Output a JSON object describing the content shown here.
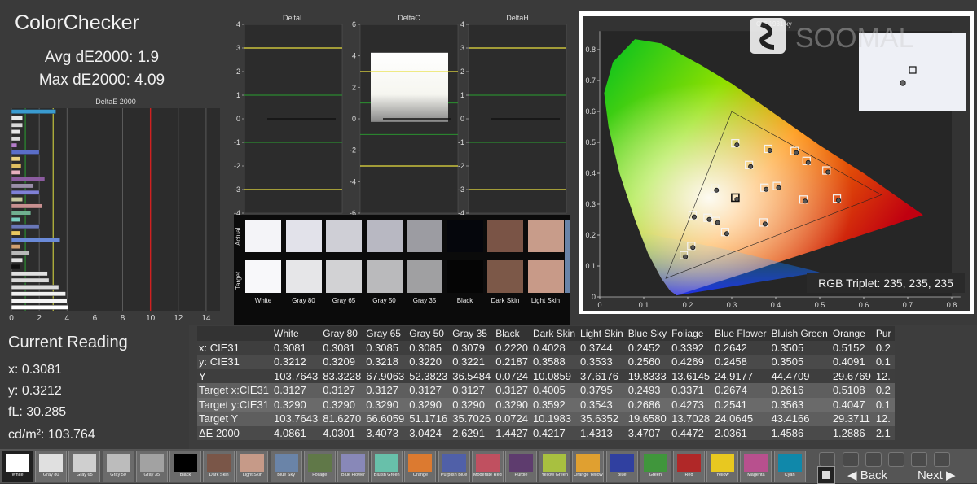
{
  "header": {
    "title": "ColorChecker",
    "avg": "Avg dE2000: 1.9",
    "max": "Max dE2000: 4.09"
  },
  "deltae_chart": {
    "title": "DeltaE 2000",
    "ticks": [
      "0",
      "2",
      "4",
      "6",
      "8",
      "10",
      "12",
      "14"
    ],
    "xlim": [
      0,
      15
    ],
    "bars": [
      {
        "value": 3.2,
        "color": "#3a9bd0"
      },
      {
        "value": 0.8,
        "color": "#e8e8e8"
      },
      {
        "value": 0.8,
        "color": "#d8d8d8"
      },
      {
        "value": 0.6,
        "color": "#e8e8e8"
      },
      {
        "value": 0.6,
        "color": "#dcdcdc"
      },
      {
        "value": 0.4,
        "color": "#b37cc8"
      },
      {
        "value": 2.0,
        "color": "#5a6ec8"
      },
      {
        "value": 0.6,
        "color": "#e8d080"
      },
      {
        "value": 0.7,
        "color": "#e0c060"
      },
      {
        "value": 0.6,
        "color": "#e8b0c0"
      },
      {
        "value": 2.4,
        "color": "#8c5ca0"
      },
      {
        "value": 1.6,
        "color": "#9a8ea8"
      },
      {
        "value": 2.0,
        "color": "#7f80d6"
      },
      {
        "value": 0.8,
        "color": "#c8c8a0"
      },
      {
        "value": 2.2,
        "color": "#c89090"
      },
      {
        "value": 1.4,
        "color": "#70b090"
      },
      {
        "value": 0.6,
        "color": "#7ad0c0"
      },
      {
        "value": 2.0,
        "color": "#6a78b8"
      },
      {
        "value": 0.6,
        "color": "#e8c860"
      },
      {
        "value": 3.5,
        "color": "#6a8ad8"
      },
      {
        "value": 0.6,
        "color": "#d0a070"
      },
      {
        "value": 1.3,
        "color": "#b8b8b8"
      },
      {
        "value": 0.8,
        "color": "#e0e0e0"
      },
      {
        "value": 0.6,
        "color": "#101010"
      },
      {
        "value": 2.6,
        "color": "#e0e0e0"
      },
      {
        "value": 2.7,
        "color": "#d8d8d8"
      },
      {
        "value": 3.4,
        "color": "#dcdcdc"
      },
      {
        "value": 3.9,
        "color": "#f0f0f0"
      },
      {
        "value": 4.0,
        "color": "#f4f4f4"
      },
      {
        "value": 4.09,
        "color": "#ffffff"
      }
    ]
  },
  "delta_charts": [
    {
      "title": "DeltaL",
      "ticks": [
        "4",
        "3",
        "2",
        "1",
        "0",
        "-1",
        "-2",
        "-3",
        "-4"
      ]
    },
    {
      "title": "DeltaC",
      "ticks": [
        "6",
        "4",
        "2",
        "0",
        "-2",
        "-4",
        "-6"
      ]
    },
    {
      "title": "DeltaH",
      "ticks": [
        "4",
        "3",
        "2",
        "1",
        "0",
        "-1",
        "-2",
        "-3",
        "-4"
      ]
    }
  ],
  "swatches": {
    "row_actual": "Actual",
    "row_target": "Target",
    "items": [
      {
        "label": "White",
        "actual": "#f4f4f8",
        "target": "#f8f8fa"
      },
      {
        "label": "Gray 80",
        "actual": "#e2e2ea",
        "target": "#e6e6e8"
      },
      {
        "label": "Gray 65",
        "actual": "#cfcfd6",
        "target": "#d2d2d4"
      },
      {
        "label": "Gray 50",
        "actual": "#b8b8c2",
        "target": "#bababc"
      },
      {
        "label": "Gray 35",
        "actual": "#9c9ca2",
        "target": "#a0a0a2"
      },
      {
        "label": "Black",
        "actual": "#05060c",
        "target": "#050505"
      },
      {
        "label": "Dark Skin",
        "actual": "#7a5446",
        "target": "#7c5848"
      },
      {
        "label": "Light Skin",
        "actual": "#c89c8a",
        "target": "#c89a88"
      }
    ]
  },
  "cie": {
    "title": "CIE 1931 xy",
    "watermark": "SOOMAL",
    "rgb_triplet": "RGB Triplet: 235, 235, 235",
    "xticks": [
      "0",
      "0.1",
      "0.2",
      "0.3",
      "0.4",
      "0.5",
      "0.6",
      "0.7",
      "0.8"
    ],
    "yticks": [
      "0",
      "0.1",
      "0.2",
      "0.3",
      "0.4",
      "0.5",
      "0.6",
      "0.7",
      "0.8"
    ],
    "gamut": [
      [
        0.64,
        0.33
      ],
      [
        0.3,
        0.6
      ],
      [
        0.15,
        0.06
      ]
    ],
    "points": [
      [
        0.3081,
        0.3212
      ],
      [
        0.4028,
        0.3588
      ],
      [
        0.3744,
        0.3533
      ],
      [
        0.2452,
        0.256
      ],
      [
        0.3392,
        0.4269
      ],
      [
        0.2642,
        0.2458
      ],
      [
        0.2616,
        0.3505
      ],
      [
        0.5152,
        0.4091
      ],
      [
        0.208,
        0.165
      ],
      [
        0.463,
        0.315
      ],
      [
        0.285,
        0.21
      ],
      [
        0.383,
        0.479
      ],
      [
        0.47,
        0.44
      ],
      [
        0.191,
        0.135
      ],
      [
        0.308,
        0.497
      ],
      [
        0.539,
        0.318
      ],
      [
        0.443,
        0.472
      ],
      [
        0.372,
        0.241
      ],
      [
        0.211,
        0.264
      ]
    ]
  },
  "current_reading": {
    "title": "Current Reading",
    "x": "x: 0.3081",
    "y": "y: 0.3212",
    "fl": "fL: 30.285",
    "cdm2": "cd/m²: 103.764"
  },
  "table": {
    "columns": [
      "",
      "White",
      "Gray 80",
      "Gray 65",
      "Gray 50",
      "Gray 35",
      "Black",
      "Dark Skin",
      "Light Skin",
      "Blue Sky",
      "Foliage",
      "Blue Flower",
      "Bluish Green",
      "Orange",
      "Pur"
    ],
    "rows": [
      [
        "x: CIE31",
        "0.3081",
        "0.3081",
        "0.3085",
        "0.3085",
        "0.3079",
        "0.2220",
        "0.4028",
        "0.3744",
        "0.2452",
        "0.3392",
        "0.2642",
        "0.3505",
        "0.5152",
        "0.2"
      ],
      [
        "y: CIE31",
        "0.3212",
        "0.3209",
        "0.3218",
        "0.3220",
        "0.3221",
        "0.2187",
        "0.3588",
        "0.3533",
        "0.2560",
        "0.4269",
        "0.2458",
        "0.3505",
        "0.4091",
        "0.1"
      ],
      [
        "Y",
        "103.7643",
        "83.3228",
        "67.9063",
        "52.3823",
        "36.5484",
        "0.0724",
        "10.0859",
        "37.6176",
        "19.8333",
        "13.6145",
        "24.9177",
        "44.4709",
        "29.6769",
        "12."
      ],
      [
        "Target x:CIE31",
        "0.3127",
        "0.3127",
        "0.3127",
        "0.3127",
        "0.3127",
        "0.3127",
        "0.4005",
        "0.3795",
        "0.2493",
        "0.3371",
        "0.2674",
        "0.2616",
        "0.5108",
        "0.2"
      ],
      [
        "Target y:CIE31",
        "0.3290",
        "0.3290",
        "0.3290",
        "0.3290",
        "0.3290",
        "0.3290",
        "0.3592",
        "0.3543",
        "0.2686",
        "0.4273",
        "0.2541",
        "0.3563",
        "0.4047",
        "0.1"
      ],
      [
        "Target Y",
        "103.7643",
        "81.6270",
        "66.6059",
        "51.1716",
        "35.7026",
        "0.0724",
        "10.1983",
        "35.6352",
        "19.6580",
        "13.7028",
        "24.0645",
        "43.4166",
        "29.3711",
        "12."
      ],
      [
        "ΔE 2000",
        "4.0861",
        "4.0301",
        "3.4073",
        "3.0424",
        "2.6291",
        "1.4427",
        "0.4217",
        "1.4313",
        "3.4707",
        "0.4472",
        "2.0361",
        "1.4586",
        "1.2886",
        "2.1"
      ]
    ]
  },
  "patches": [
    {
      "label": "White",
      "color": "#ffffff",
      "active": true
    },
    {
      "label": "Gray 80",
      "color": "#e0e0e0"
    },
    {
      "label": "Gray 65",
      "color": "#cfcfcf"
    },
    {
      "label": "Gray 50",
      "color": "#bcbcbc"
    },
    {
      "label": "Gray 35",
      "color": "#a2a2a2"
    },
    {
      "label": "Black",
      "color": "#000000"
    },
    {
      "label": "Dark Skin",
      "color": "#7a5648"
    },
    {
      "label": "Light Skin",
      "color": "#c69a88"
    },
    {
      "label": "Blue Sky",
      "color": "#6a84a8"
    },
    {
      "label": "Foliage",
      "color": "#607848"
    },
    {
      "label": "Blue Flower",
      "color": "#8888b8"
    },
    {
      "label": "Bluish Green",
      "color": "#68c0aa"
    },
    {
      "label": "Orange",
      "color": "#dc7a30"
    },
    {
      "label": "Purplish Blue",
      "color": "#5060a8"
    },
    {
      "label": "Moderate Red",
      "color": "#c05060"
    },
    {
      "label": "Purple",
      "color": "#5e3c6e"
    },
    {
      "label": "Yellow Green",
      "color": "#a8c040"
    },
    {
      "label": "Orange Yellow",
      "color": "#e0a030"
    },
    {
      "label": "Blue",
      "color": "#3040a0"
    },
    {
      "label": "Green",
      "color": "#40963c"
    },
    {
      "label": "Red",
      "color": "#b02828"
    },
    {
      "label": "Yellow",
      "color": "#e8c820"
    },
    {
      "label": "Magenta",
      "color": "#b8508e"
    },
    {
      "label": "Cyan",
      "color": "#1088aa"
    }
  ],
  "nav": {
    "back": "Back",
    "next": "Next"
  }
}
